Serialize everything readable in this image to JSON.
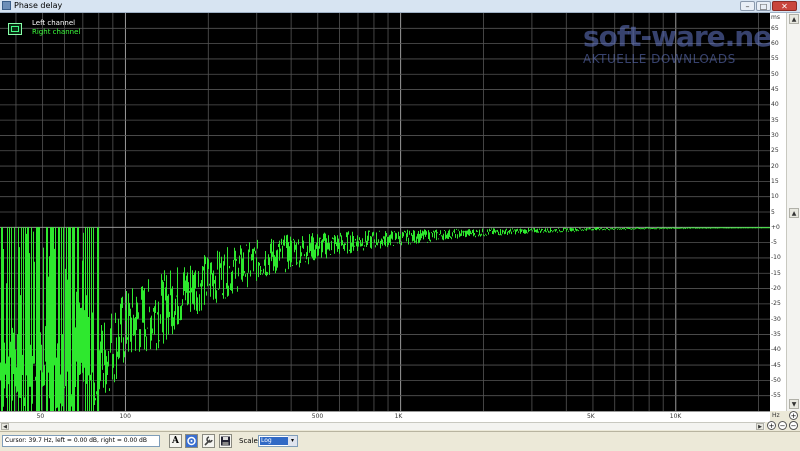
{
  "window": {
    "title": "Phase delay",
    "minimize_glyph": "–",
    "maximize_glyph": "□",
    "close_glyph": "✕"
  },
  "legend": {
    "left_channel": "Left channel",
    "right_channel": "Right channel",
    "left_color": "#ffffff",
    "right_color": "#3cff3c"
  },
  "watermark": {
    "line1": "soft-ware.net",
    "line2": "AKTUELLE DOWNLOADS"
  },
  "chart_data": {
    "type": "line",
    "xscale": "log",
    "xlim": [
      35,
      22000
    ],
    "ylim": [
      -60,
      70
    ],
    "grid": true,
    "x_unit": "Hz",
    "y_unit": "ms",
    "series_color": "#2ee82e",
    "x_tick_labels": [
      {
        "value": 50,
        "label": "50"
      },
      {
        "value": 100,
        "label": "100"
      },
      {
        "value": 500,
        "label": "500"
      },
      {
        "value": 1000,
        "label": "1K"
      },
      {
        "value": 5000,
        "label": "5K"
      },
      {
        "value": 10000,
        "label": "10K"
      }
    ],
    "y_tick_labels": [
      {
        "value": 65,
        "label": "65"
      },
      {
        "value": 60,
        "label": "60"
      },
      {
        "value": 55,
        "label": "55"
      },
      {
        "value": 50,
        "label": "50"
      },
      {
        "value": 45,
        "label": "45"
      },
      {
        "value": 40,
        "label": "40"
      },
      {
        "value": 35,
        "label": "35"
      },
      {
        "value": 30,
        "label": "30"
      },
      {
        "value": 25,
        "label": "25"
      },
      {
        "value": 20,
        "label": "20"
      },
      {
        "value": 15,
        "label": "15"
      },
      {
        "value": 10,
        "label": "10"
      },
      {
        "value": 5,
        "label": "5"
      },
      {
        "value": 0,
        "label": "+0"
      },
      {
        "value": -5,
        "label": "-5"
      },
      {
        "value": -10,
        "label": "-10"
      },
      {
        "value": -15,
        "label": "-15"
      },
      {
        "value": -20,
        "label": "-20"
      },
      {
        "value": -25,
        "label": "-25"
      },
      {
        "value": -30,
        "label": "-30"
      },
      {
        "value": -35,
        "label": "-35"
      },
      {
        "value": -40,
        "label": "-40"
      },
      {
        "value": -45,
        "label": "-45"
      },
      {
        "value": -50,
        "label": "-50"
      },
      {
        "value": -55,
        "label": "-55"
      }
    ],
    "envelope": [
      {
        "x": 35,
        "lo": -60,
        "hi": 0
      },
      {
        "x": 50,
        "lo": -60,
        "hi": 0
      },
      {
        "x": 60,
        "lo": -60,
        "hi": 0
      },
      {
        "x": 70,
        "lo": -60,
        "hi": -1
      },
      {
        "x": 80,
        "lo": -60,
        "hi": -30
      },
      {
        "x": 100,
        "lo": -45,
        "hi": -20
      },
      {
        "x": 130,
        "lo": -40,
        "hi": -15
      },
      {
        "x": 170,
        "lo": -30,
        "hi": -10
      },
      {
        "x": 200,
        "lo": -26,
        "hi": -8
      },
      {
        "x": 300,
        "lo": -18,
        "hi": -4
      },
      {
        "x": 400,
        "lo": -14,
        "hi": -2
      },
      {
        "x": 500,
        "lo": -11,
        "hi": -1.5
      },
      {
        "x": 700,
        "lo": -8,
        "hi": -1
      },
      {
        "x": 1000,
        "lo": -6,
        "hi": -0.8
      },
      {
        "x": 1500,
        "lo": -4,
        "hi": -0.5
      },
      {
        "x": 2000,
        "lo": -3,
        "hi": -0.3
      },
      {
        "x": 3000,
        "lo": -2,
        "hi": -0.2
      },
      {
        "x": 5000,
        "lo": -1,
        "hi": 0
      },
      {
        "x": 7000,
        "lo": -0.6,
        "hi": 0
      },
      {
        "x": 10000,
        "lo": -0.3,
        "hi": 0
      },
      {
        "x": 15000,
        "lo": -0.1,
        "hi": 0
      },
      {
        "x": 22000,
        "lo": 0,
        "hi": 0
      }
    ]
  },
  "status": {
    "cursor_text": "Cursor: 39.7 Hz, left = 0.00 dB, right = 0.00 dB",
    "scale_label": "Scale",
    "scale_value": "Log",
    "font_button": "A",
    "dropdown_glyph": "▾"
  },
  "scroll": {
    "up": "▲",
    "down": "▼",
    "left": "◀",
    "right": "▶"
  },
  "zoom": {
    "in": "+",
    "out": "−"
  }
}
